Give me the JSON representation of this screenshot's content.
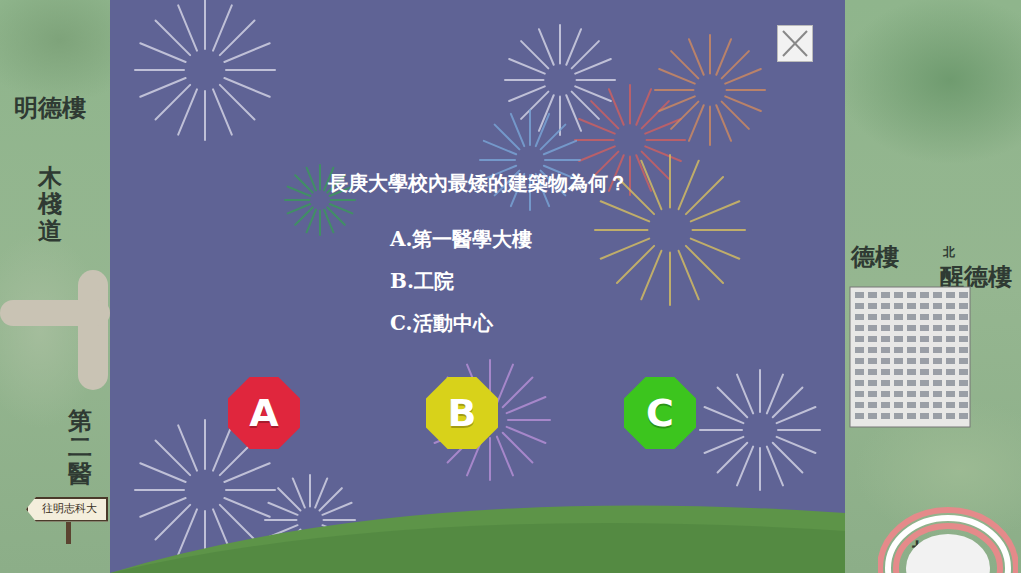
{
  "map": {
    "labels": [
      {
        "text": "明德樓",
        "kind": "horizontal"
      },
      {
        "text": "木棧道",
        "kind": "vertical"
      },
      {
        "text": "第二醫",
        "kind": "vertical"
      },
      {
        "text": "德樓",
        "kind": "horizontal"
      },
      {
        "text": "北",
        "kind": "small"
      },
      {
        "text": "醒德樓",
        "kind": "horizontal"
      },
      {
        "text": "操",
        "kind": "horizontal"
      }
    ],
    "sign": "往明志科大"
  },
  "quiz": {
    "question": "長庚大學校內最矮的建築物為何？",
    "options": [
      "A.第一醫學大樓",
      "B.工院",
      "C.活動中心"
    ],
    "buttons": [
      {
        "label": "A",
        "color": "#e0263d"
      },
      {
        "label": "B",
        "color": "#d8d21a"
      },
      {
        "label": "C",
        "color": "#3cc51e"
      }
    ]
  }
}
